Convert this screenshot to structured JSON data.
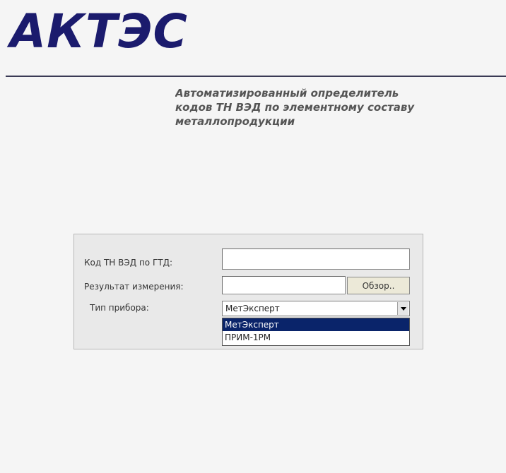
{
  "header": {
    "logo_text": "АКТЭС",
    "subtitle_lines": [
      "Автоматизированный определитель",
      "кодов ТН ВЭД по элементному составу",
      "металлопродукции"
    ]
  },
  "form": {
    "tnved_label": "Код ТН ВЭД по ГТД:",
    "tnved_value": "",
    "measurement_label": "Результат измерения:",
    "measurement_value": "",
    "browse_label": "Обзор..",
    "device_type_label": "Тип прибора:",
    "device_type_selected": "МетЭксперт",
    "device_type_options": [
      {
        "label": "МетЭксперт",
        "selected": true
      },
      {
        "label": "ПРИМ-1РМ",
        "selected": false
      }
    ]
  },
  "colors": {
    "logo": "#1b1b6d",
    "subtitle": "#555555",
    "panel_bg": "#e9e9e9",
    "selection_bg": "#0a246a"
  },
  "icons": {
    "select_arrow": "triangle-down-icon"
  }
}
